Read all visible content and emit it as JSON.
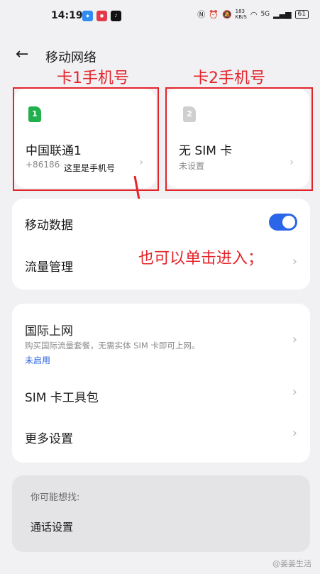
{
  "status_bar": {
    "time": "14:19",
    "speed": "183\nKB/S",
    "network_type": "5G",
    "battery": "61"
  },
  "header": {
    "title": "移动网络"
  },
  "annotations": {
    "sim1_label": "卡1手机号",
    "sim2_label": "卡2手机号",
    "phone_note": "这里是手机号",
    "click_note": "也可以单击进入；"
  },
  "sim_cards": [
    {
      "badge": "1",
      "name": "中国联通1",
      "number": "+86186",
      "badge_color": "#22b04d"
    },
    {
      "badge": "2",
      "name": "无 SIM 卡",
      "status": "未设置",
      "badge_color": "#cfcfcf"
    }
  ],
  "mobile_group": {
    "mobile_data": "移动数据",
    "mobile_data_on": true,
    "data_usage": "流量管理"
  },
  "settings_group": {
    "intl_title": "国际上网",
    "intl_desc": "购买国际流量套餐，无需实体 SIM 卡即可上网。",
    "intl_status": "未启用",
    "sim_toolkit": "SIM 卡工具包",
    "more_settings": "更多设置"
  },
  "suggest": {
    "heading": "你可能想找:",
    "item": "通话设置"
  },
  "watermark": "@姜姜生活",
  "colors": {
    "accent": "#2b66e8",
    "annotation": "#e3242b",
    "sim1": "#22b04d"
  }
}
